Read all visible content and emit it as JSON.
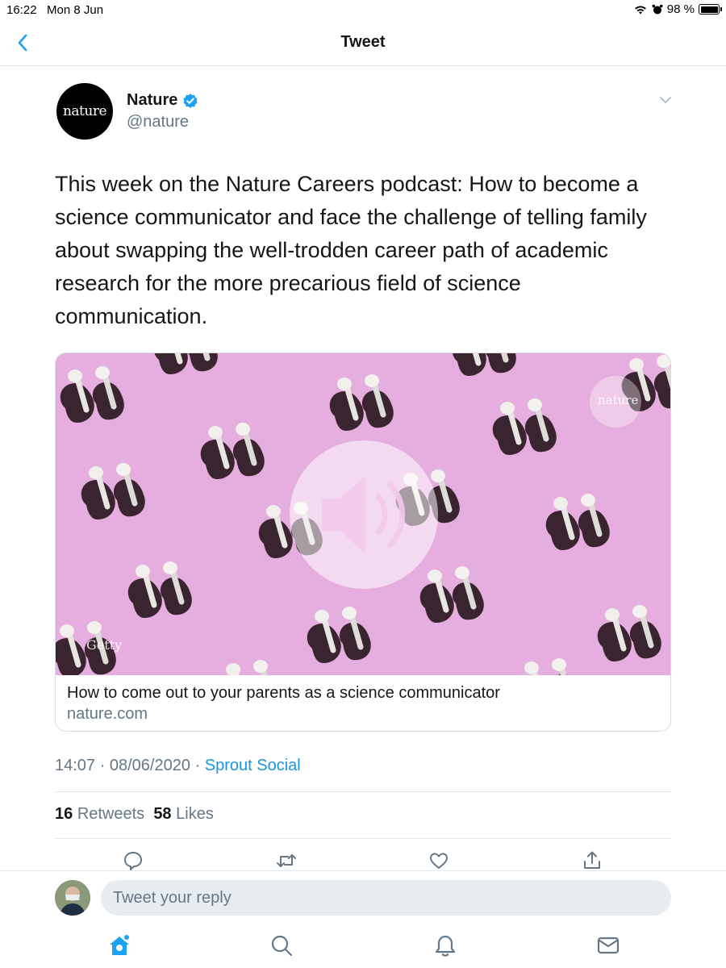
{
  "status_bar": {
    "time": "16:22",
    "date": "Mon 8 Jun",
    "battery_text": "98 %",
    "battery_level": 0.98,
    "icons": [
      "wifi-icon",
      "alarm-icon",
      "battery-icon"
    ]
  },
  "header": {
    "title": "Tweet",
    "back_icon": "chevron-left-icon"
  },
  "tweet": {
    "author": {
      "avatar_text": "nature",
      "name": "Nature",
      "verified": true,
      "handle": "@nature"
    },
    "text": "This week on the Nature Careers podcast: How to become a science communicator and face the challenge of telling family about swapping the well-trodden career path of academic research for the more precarious field of science communication.",
    "card": {
      "image_watermark": "nature",
      "image_credit": "Getty",
      "title": "How to come out to your parents as a science communicator",
      "domain": "nature.com"
    },
    "time": "14:07",
    "date": "08/06/2020",
    "separator": "·",
    "source": "Sprout Social",
    "retweets_count": "16",
    "retweets_label": "Retweets",
    "likes_count": "58",
    "likes_label": "Likes"
  },
  "actions": [
    "reply-icon",
    "retweet-icon",
    "like-icon",
    "share-icon"
  ],
  "reply": {
    "placeholder": "Tweet your reply"
  },
  "tab_bar": [
    "home-icon",
    "search-icon",
    "notifications-icon",
    "messages-icon"
  ],
  "colors": {
    "accent": "#1da1f2",
    "link": "#1b95e0",
    "secondary_text": "#657786",
    "card_background": "#e6aede"
  }
}
